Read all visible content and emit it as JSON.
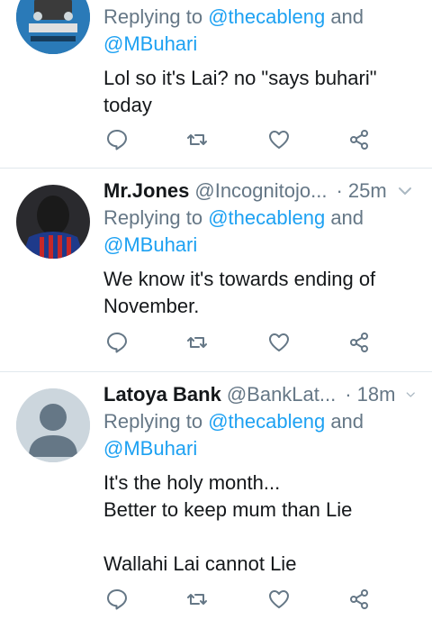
{
  "tweets": [
    {
      "name": "",
      "handle": "",
      "time": "",
      "reply_prefix": "Replying to",
      "reply_to_1": "@thecableng",
      "reply_and": "and",
      "reply_to_2": "@MBuhari",
      "text_lines": [
        "Lol so it's Lai?  no \"says buhari\"",
        "today"
      ]
    },
    {
      "name": "Mr.Jones",
      "handle": "@Incognitojo...",
      "time": "· 25m",
      "reply_prefix": "Replying to",
      "reply_to_1": "@thecableng",
      "reply_and": "and",
      "reply_to_2": "@MBuhari",
      "text_lines": [
        "We know it's towards ending of",
        "November."
      ]
    },
    {
      "name": "Latoya Bank",
      "handle": "@BankLat...",
      "time": "· 18m",
      "reply_prefix": "Replying to",
      "reply_to_1": "@thecableng",
      "reply_and": "and",
      "reply_to_2": "@MBuhari",
      "text_lines": [
        "It's the holy month...",
        "Better to keep mum than Lie",
        "",
        "Wallahi Lai cannot Lie"
      ]
    }
  ],
  "icons": {
    "reply": "reply-icon",
    "retweet": "retweet-icon",
    "like": "heart-icon",
    "share": "share-icon",
    "more": "chevron-down-icon"
  },
  "colors": {
    "link": "#1da1f2",
    "secondary": "#657786",
    "text": "#14171a",
    "divider": "#e1e8ed"
  }
}
